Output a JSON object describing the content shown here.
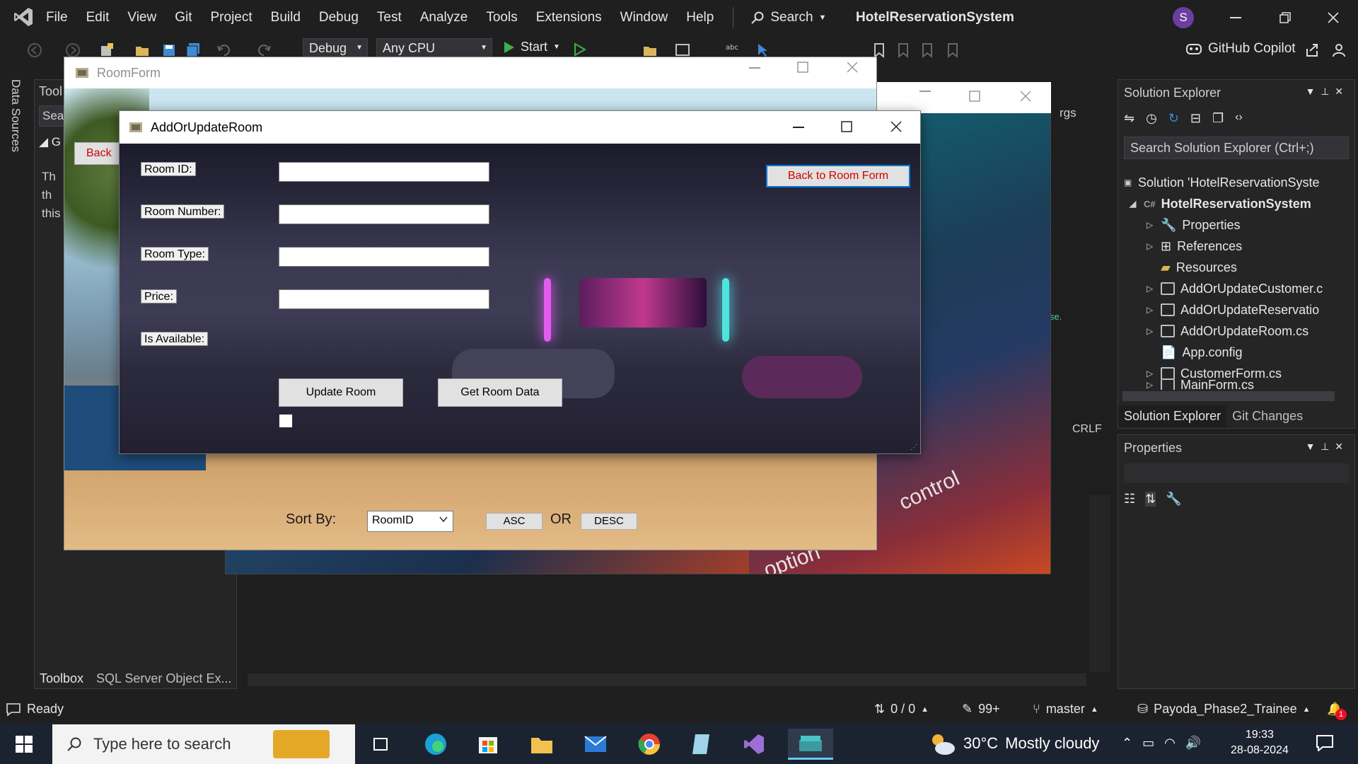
{
  "vs": {
    "menu": [
      "File",
      "Edit",
      "View",
      "Git",
      "Project",
      "Build",
      "Debug",
      "Test",
      "Analyze",
      "Tools",
      "Extensions",
      "Window",
      "Help"
    ],
    "search_label": "Search",
    "solution_title": "HotelReservationSystem",
    "user_initial": "S",
    "toolbar": {
      "config": "Debug",
      "platform": "Any CPU",
      "start": "Start",
      "copilot": "GitHub Copilot"
    }
  },
  "left": {
    "data_sources": "Data Sources"
  },
  "toolbox": {
    "title": "Tool",
    "search": "Sea",
    "group": "G",
    "text_lines": [
      "Th",
      "th",
      "this"
    ],
    "tabs": [
      "Toolbox",
      "SQL Server Object Ex..."
    ]
  },
  "editor": {
    "args_label": "rgs",
    "crlf": "CRLF",
    "code_fragment": "se."
  },
  "solution_explorer": {
    "title": "Solution Explorer",
    "search_placeholder": "Search Solution Explorer (Ctrl+;)",
    "items": [
      {
        "label": "Solution 'HotelReservationSyste"
      },
      {
        "label": "HotelReservationSystem"
      },
      {
        "label": "Properties"
      },
      {
        "label": "References"
      },
      {
        "label": "Resources"
      },
      {
        "label": "AddOrUpdateCustomer.c"
      },
      {
        "label": "AddOrUpdateReservatio"
      },
      {
        "label": "AddOrUpdateRoom.cs"
      },
      {
        "label": "App.config"
      },
      {
        "label": "CustomerForm.cs"
      },
      {
        "label": "MainForm.cs"
      }
    ],
    "tabs": [
      "Solution Explorer",
      "Git Changes"
    ]
  },
  "properties": {
    "title": "Properties"
  },
  "status": {
    "ready": "Ready",
    "lines": "0 / 0",
    "edits": "99+",
    "branch": "master",
    "repo": "Payoda_Phase2_Trainee",
    "notifications": "1"
  },
  "taskbar": {
    "search_placeholder": "Type here to search",
    "weather_temp": "30°C",
    "weather_desc": "Mostly cloudy",
    "time": "19:33",
    "date": "28-08-2024"
  },
  "roomform": {
    "title": "RoomForm",
    "back_label": "Back",
    "sort_by": "Sort By:",
    "sort_value": "RoomID",
    "asc": "ASC",
    "or": "OR",
    "desc": "DESC"
  },
  "addroom": {
    "title": "AddOrUpdateRoom",
    "labels": {
      "room_id": "Room ID:",
      "room_number": "Room Number:",
      "room_type": "Room Type:",
      "price": "Price:",
      "is_available": "Is Available:"
    },
    "update_btn": "Update Room",
    "get_btn": "Get Room Data",
    "back_btn": "Back to Room Form"
  },
  "bg_text": {
    "control": "control",
    "option": "option"
  },
  "colors": {
    "accent": "#0078d7",
    "danger": "#d40000",
    "vs_bg": "#1f1f1f",
    "panel": "#252526"
  }
}
